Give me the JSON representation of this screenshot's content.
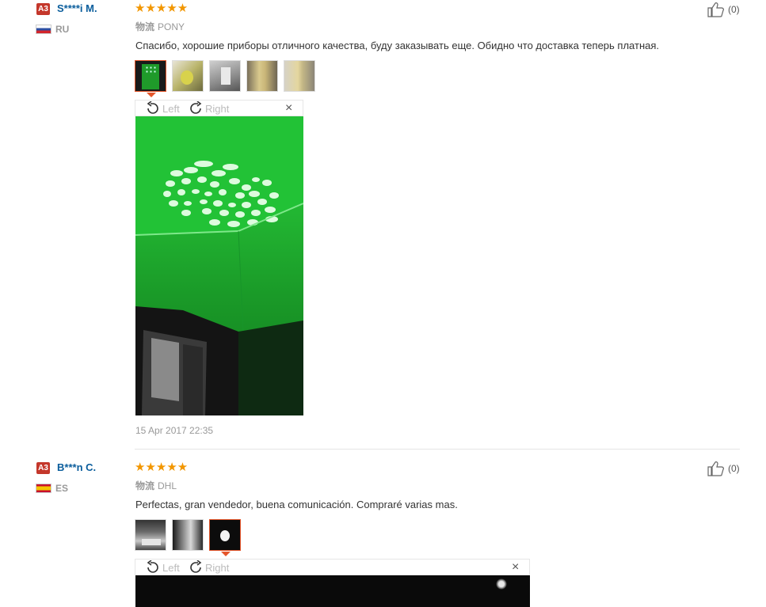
{
  "reviews": [
    {
      "level_badge": "A3",
      "user": "S****i M.",
      "country": "RU",
      "stars": "★★★★★",
      "shipping_label": "物流",
      "shipping": "PONY",
      "text": "Спасибо, хорошие приборы отличного качества, буду заказывать еще. Обидно что доставка теперь платная.",
      "helpful": "(0)",
      "rotate_left": "Left",
      "rotate_right": "Right",
      "close": "×",
      "date": "15 Apr 2017 22:35"
    },
    {
      "level_badge": "A3",
      "user": "B***n C.",
      "country": "ES",
      "stars": "★★★★★",
      "shipping_label": "物流",
      "shipping": "DHL",
      "text": "Perfectas, gran vendedor, buena comunicación. Compraré varias mas.",
      "helpful": "(0)",
      "rotate_left": "Left",
      "rotate_right": "Right",
      "close": "×"
    }
  ],
  "colors": {
    "user": "#0a5d9c",
    "stars": "#f29600",
    "badge": "#c4372b",
    "selected": "#e5562b"
  }
}
